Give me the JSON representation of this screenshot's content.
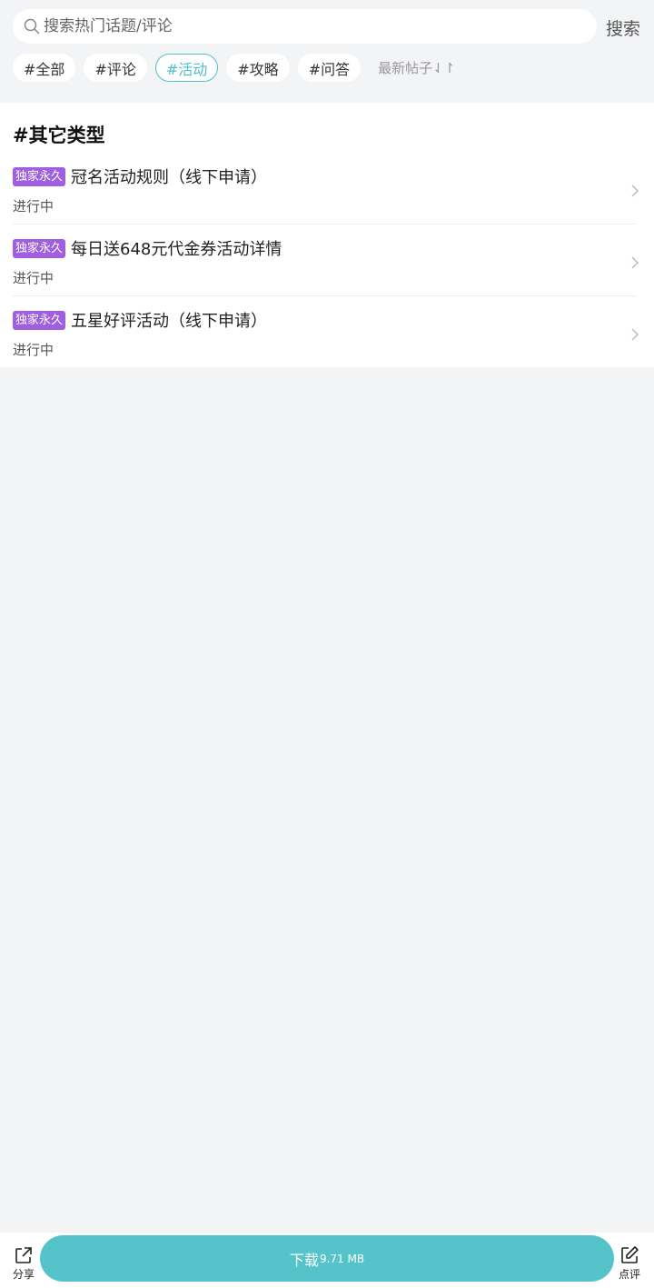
{
  "search": {
    "placeholder": "搜索热门话题/评论",
    "button_label": "搜索"
  },
  "tags": [
    {
      "label": "#全部",
      "active": false
    },
    {
      "label": "#评论",
      "active": false
    },
    {
      "label": "#活动",
      "active": true
    },
    {
      "label": "#攻略",
      "active": false
    },
    {
      "label": "#问答",
      "active": false
    }
  ],
  "sort_label": "最新帖子⇃↾",
  "section": {
    "title": "#其它类型",
    "items": [
      {
        "badge": "独家永久",
        "title": "冠名活动规则（线下申请）",
        "status": "进行中"
      },
      {
        "badge": "独家永久",
        "title": "每日送648元代金券活动详情",
        "status": "进行中"
      },
      {
        "badge": "独家永久",
        "title": "五星好评活动（线下申请）",
        "status": "进行中"
      }
    ]
  },
  "bottom": {
    "share_label": "分享",
    "download_label": "下载",
    "download_size": "9.71 MB",
    "review_label": "点评"
  },
  "colors": {
    "accent": "#55c3ca",
    "active_tag": "#4fbfc8",
    "badge": "#a05ee0",
    "background": "#f3f4f6"
  },
  "icons": {
    "search": "search-icon",
    "share": "share-icon",
    "review": "edit-icon",
    "chevron": "chevron-right-icon"
  }
}
